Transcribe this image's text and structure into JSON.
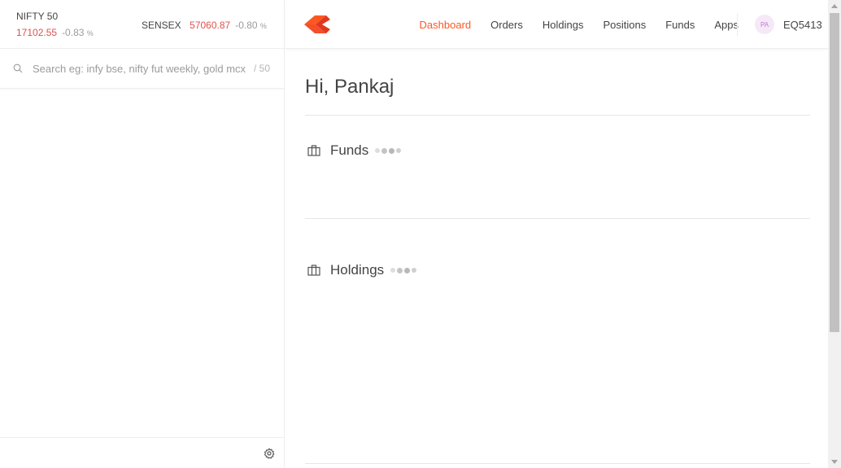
{
  "indices": {
    "nifty": {
      "name": "NIFTY 50",
      "value": "17102.55",
      "change": "-0.83",
      "unit": "%"
    },
    "sensex": {
      "name": "SENSEX",
      "value": "57060.87",
      "change": "-0.80",
      "unit": "%"
    }
  },
  "search": {
    "placeholder": "Search eg: infy bse, nifty fut weekly, gold mcx",
    "count": "/ 50"
  },
  "nav": {
    "items": [
      {
        "label": "Dashboard",
        "active": true
      },
      {
        "label": "Orders"
      },
      {
        "label": "Holdings"
      },
      {
        "label": "Positions"
      },
      {
        "label": "Funds"
      },
      {
        "label": "Apps"
      }
    ]
  },
  "user": {
    "initials": "PA",
    "id": "EQ5413"
  },
  "main": {
    "greeting": "Hi, Pankaj",
    "sections": [
      {
        "title": "Funds"
      },
      {
        "title": "Holdings"
      }
    ]
  },
  "colors": {
    "accent": "#ff5722",
    "negative": "#df514c",
    "avatar_bg": "#f5e9f8",
    "avatar_fg": "#c07bd1"
  },
  "icons": {
    "search": "search-icon",
    "settings": "gear-icon",
    "section": "briefcase-icon",
    "logo": "kite-logo"
  }
}
